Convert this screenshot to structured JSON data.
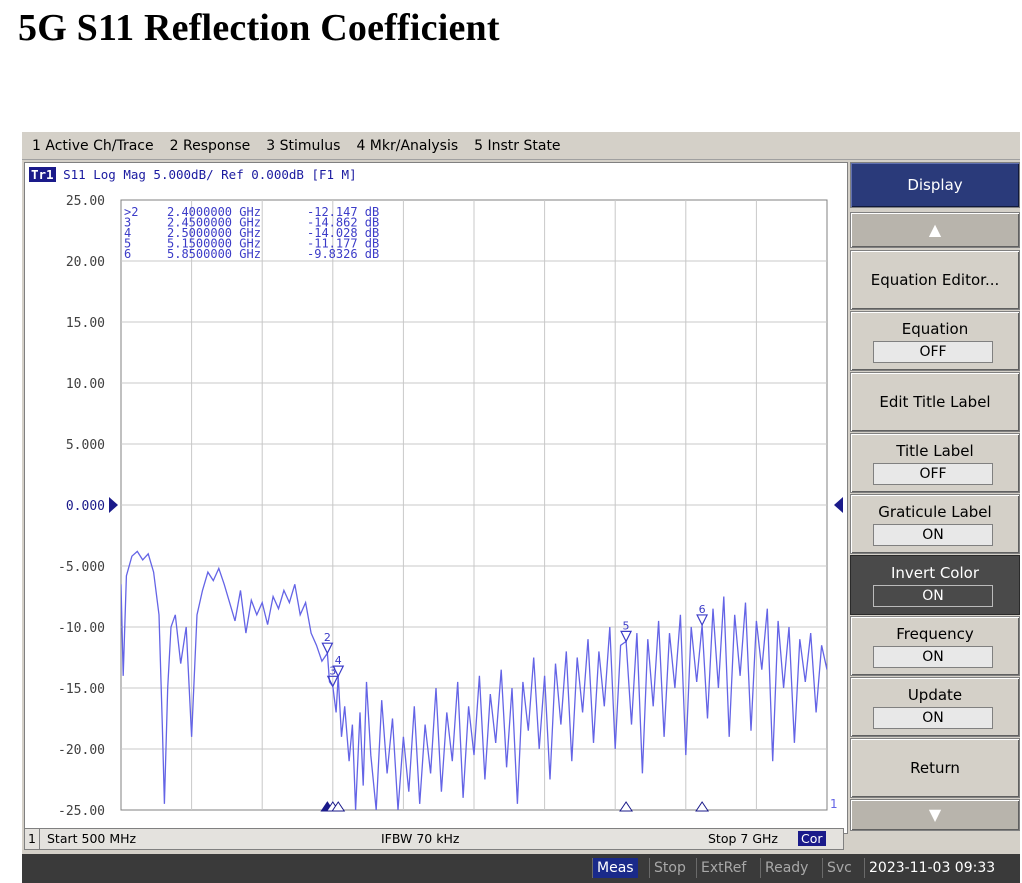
{
  "page_title": "5G S11 Reflection Coefficient",
  "menu": [
    "1 Active Ch/Trace",
    "2 Response",
    "3 Stimulus",
    "4 Mkr/Analysis",
    "5 Instr State"
  ],
  "trace_header": {
    "badge": "Tr1",
    "text": "S11 Log Mag 5.000dB/ Ref 0.000dB [F1 M]"
  },
  "markers": [
    {
      "id": "2",
      "prefix": ">2",
      "freq": "2.4000000 GHz",
      "value": "-12.147 dB"
    },
    {
      "id": "3",
      "prefix": "3",
      "freq": "2.4500000 GHz",
      "value": "-14.862 dB"
    },
    {
      "id": "4",
      "prefix": "4",
      "freq": "2.5000000 GHz",
      "value": "-14.028 dB"
    },
    {
      "id": "5",
      "prefix": "5",
      "freq": "5.1500000 GHz",
      "value": "-11.177 dB"
    },
    {
      "id": "6",
      "prefix": "6",
      "freq": "5.8500000 GHz",
      "value": "-9.8326 dB"
    }
  ],
  "channel_status": {
    "channel": "1",
    "start": "Start 500 MHz",
    "ifbw": "IFBW 70 kHz",
    "stop": "Stop 7 GHz",
    "cor": "Cor",
    "trace_end_label": "1"
  },
  "softkeys": {
    "display": "Display",
    "equation_editor": "Equation Editor...",
    "equation": {
      "label": "Equation",
      "value": "OFF"
    },
    "edit_title_label": "Edit Title Label",
    "title_label": {
      "label": "Title Label",
      "value": "OFF"
    },
    "graticule_label": {
      "label": "Graticule Label",
      "value": "ON"
    },
    "invert_color": {
      "label": "Invert Color",
      "value": "ON"
    },
    "frequency": {
      "label": "Frequency",
      "value": "ON"
    },
    "update": {
      "label": "Update",
      "value": "ON"
    },
    "return": "Return",
    "scroll_up_icon": "triangle-up",
    "scroll_down_icon": "triangle-down"
  },
  "instrument_status": {
    "meas": "Meas",
    "stop": "Stop",
    "extref": "ExtRef",
    "ready": "Ready",
    "svc": "Svc",
    "datetime": "2023-11-03 09:33"
  },
  "colors": {
    "trace": "#6464e6",
    "marker_text": "#3c3cc8",
    "header_accent": "#2a3a7a",
    "reference_marker": "#1a1a8a"
  },
  "chart_data": {
    "type": "line",
    "title": "S11 Log Mag 5.000dB/ Ref 0.000dB",
    "xlabel": "",
    "ylabel": "",
    "x_start_ghz": 0.5,
    "x_stop_ghz": 7.0,
    "ylim": [
      -25,
      25
    ],
    "y_ticks": [
      "25.00",
      "20.00",
      "15.00",
      "10.00",
      "5.000",
      "0.000",
      "-5.000",
      "-10.00",
      "-15.00",
      "-20.00",
      "-25.00"
    ],
    "reference_level_db": 0,
    "grid": true,
    "series": [
      {
        "points": [
          [
            0.5,
            -6.5
          ],
          [
            0.52,
            -14
          ],
          [
            0.55,
            -5.8
          ],
          [
            0.6,
            -4.2
          ],
          [
            0.65,
            -3.8
          ],
          [
            0.7,
            -4.5
          ],
          [
            0.75,
            -4.0
          ],
          [
            0.8,
            -5.5
          ],
          [
            0.85,
            -9
          ],
          [
            0.88,
            -18
          ],
          [
            0.9,
            -24.5
          ],
          [
            0.93,
            -15
          ],
          [
            0.96,
            -10
          ],
          [
            1.0,
            -9
          ],
          [
            1.05,
            -13
          ],
          [
            1.1,
            -10
          ],
          [
            1.15,
            -19
          ],
          [
            1.2,
            -9
          ],
          [
            1.25,
            -7
          ],
          [
            1.3,
            -5.5
          ],
          [
            1.35,
            -6.2
          ],
          [
            1.4,
            -5.2
          ],
          [
            1.45,
            -6.5
          ],
          [
            1.5,
            -8.0
          ],
          [
            1.55,
            -9.5
          ],
          [
            1.6,
            -7.0
          ],
          [
            1.65,
            -10.5
          ],
          [
            1.7,
            -7.8
          ],
          [
            1.75,
            -9.0
          ],
          [
            1.8,
            -8.0
          ],
          [
            1.85,
            -9.8
          ],
          [
            1.9,
            -7.5
          ],
          [
            1.95,
            -8.5
          ],
          [
            2.0,
            -7.0
          ],
          [
            2.05,
            -8.0
          ],
          [
            2.1,
            -6.5
          ],
          [
            2.15,
            -9.0
          ],
          [
            2.2,
            -8.0
          ],
          [
            2.25,
            -10.5
          ],
          [
            2.3,
            -11.5
          ],
          [
            2.35,
            -12.8
          ],
          [
            2.4,
            -12.15
          ],
          [
            2.42,
            -14.5
          ],
          [
            2.45,
            -14.86
          ],
          [
            2.48,
            -17.0
          ],
          [
            2.5,
            -14.03
          ],
          [
            2.53,
            -19.0
          ],
          [
            2.56,
            -16.5
          ],
          [
            2.6,
            -21.0
          ],
          [
            2.63,
            -18.0
          ],
          [
            2.66,
            -25.0
          ],
          [
            2.7,
            -17.0
          ],
          [
            2.73,
            -23.0
          ],
          [
            2.76,
            -14.5
          ],
          [
            2.8,
            -20.5
          ],
          [
            2.85,
            -25.0
          ],
          [
            2.9,
            -16.0
          ],
          [
            2.95,
            -22.0
          ],
          [
            3.0,
            -17.5
          ],
          [
            3.05,
            -25.0
          ],
          [
            3.1,
            -19.0
          ],
          [
            3.15,
            -23.5
          ],
          [
            3.2,
            -16.5
          ],
          [
            3.25,
            -24.5
          ],
          [
            3.3,
            -18.0
          ],
          [
            3.35,
            -22.0
          ],
          [
            3.4,
            -15.0
          ],
          [
            3.45,
            -23.5
          ],
          [
            3.5,
            -17.0
          ],
          [
            3.55,
            -21.0
          ],
          [
            3.6,
            -14.5
          ],
          [
            3.65,
            -24.0
          ],
          [
            3.7,
            -16.5
          ],
          [
            3.75,
            -20.5
          ],
          [
            3.8,
            -14.0
          ],
          [
            3.85,
            -22.5
          ],
          [
            3.9,
            -15.5
          ],
          [
            3.95,
            -19.5
          ],
          [
            4.0,
            -13.5
          ],
          [
            4.05,
            -21.5
          ],
          [
            4.1,
            -15.0
          ],
          [
            4.15,
            -24.5
          ],
          [
            4.2,
            -14.5
          ],
          [
            4.25,
            -18.5
          ],
          [
            4.3,
            -12.5
          ],
          [
            4.35,
            -20.0
          ],
          [
            4.4,
            -14.0
          ],
          [
            4.45,
            -22.5
          ],
          [
            4.5,
            -13.0
          ],
          [
            4.55,
            -18.0
          ],
          [
            4.6,
            -12.0
          ],
          [
            4.65,
            -21.0
          ],
          [
            4.7,
            -12.5
          ],
          [
            4.75,
            -17.0
          ],
          [
            4.8,
            -11.0
          ],
          [
            4.85,
            -19.5
          ],
          [
            4.9,
            -12.0
          ],
          [
            4.95,
            -16.5
          ],
          [
            5.0,
            -10.0
          ],
          [
            5.05,
            -20.0
          ],
          [
            5.1,
            -11.5
          ],
          [
            5.15,
            -11.18
          ],
          [
            5.2,
            -18.0
          ],
          [
            5.25,
            -10.5
          ],
          [
            5.3,
            -22.0
          ],
          [
            5.35,
            -11.0
          ],
          [
            5.4,
            -16.5
          ],
          [
            5.45,
            -9.5
          ],
          [
            5.5,
            -19.0
          ],
          [
            5.55,
            -10.5
          ],
          [
            5.6,
            -15.0
          ],
          [
            5.65,
            -9.0
          ],
          [
            5.7,
            -20.5
          ],
          [
            5.75,
            -10.0
          ],
          [
            5.8,
            -14.5
          ],
          [
            5.85,
            -9.83
          ],
          [
            5.9,
            -17.5
          ],
          [
            5.95,
            -8.5
          ],
          [
            6.0,
            -15.0
          ],
          [
            6.05,
            -7.5
          ],
          [
            6.1,
            -19.0
          ],
          [
            6.15,
            -9.0
          ],
          [
            6.2,
            -14.0
          ],
          [
            6.25,
            -8.0
          ],
          [
            6.3,
            -18.5
          ],
          [
            6.35,
            -9.5
          ],
          [
            6.4,
            -13.5
          ],
          [
            6.45,
            -8.5
          ],
          [
            6.5,
            -21.0
          ],
          [
            6.55,
            -9.5
          ],
          [
            6.6,
            -15.0
          ],
          [
            6.65,
            -10.0
          ],
          [
            6.7,
            -19.5
          ],
          [
            6.75,
            -11.0
          ],
          [
            6.8,
            -14.5
          ],
          [
            6.85,
            -10.5
          ],
          [
            6.9,
            -17.0
          ],
          [
            6.95,
            -11.5
          ],
          [
            7.0,
            -13.5
          ]
        ]
      }
    ],
    "marker_points": [
      {
        "id": "2",
        "x": 2.4,
        "y": -12.147,
        "active": true
      },
      {
        "id": "3",
        "x": 2.45,
        "y": -14.862,
        "active": false
      },
      {
        "id": "4",
        "x": 2.5,
        "y": -14.028,
        "active": false
      },
      {
        "id": "5",
        "x": 5.15,
        "y": -11.177,
        "active": false
      },
      {
        "id": "6",
        "x": 5.85,
        "y": -9.8326,
        "active": false
      }
    ]
  }
}
